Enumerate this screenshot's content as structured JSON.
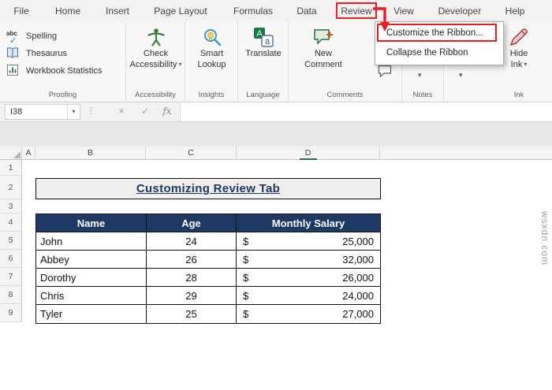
{
  "window": {
    "watermark": "wsxdn.com"
  },
  "ribbon_tabs": [
    {
      "label": "File"
    },
    {
      "label": "Home"
    },
    {
      "label": "Insert"
    },
    {
      "label": "Page Layout"
    },
    {
      "label": "Formulas"
    },
    {
      "label": "Data"
    },
    {
      "label": "Review"
    },
    {
      "label": "View"
    },
    {
      "label": "Developer"
    },
    {
      "label": "Help"
    }
  ],
  "ribbon": {
    "proofing": {
      "label": "Proofing",
      "buttons": [
        {
          "label": "Spelling"
        },
        {
          "label": "Thesaurus"
        },
        {
          "label": "Workbook Statistics"
        }
      ]
    },
    "accessibility": {
      "label": "Accessibility",
      "button_line1": "Check",
      "button_line2": "Accessibility"
    },
    "insights": {
      "label": "Insights",
      "button_line1": "Smart",
      "button_line2": "Lookup"
    },
    "language": {
      "label": "Language",
      "button": "Translate"
    },
    "comments": {
      "label": "Comments",
      "button_line1": "New",
      "button_line2": "Comment"
    },
    "notes": {
      "label": "Notes"
    },
    "ink": {
      "label": "Ink",
      "button_line1": "Hide",
      "button_line2": "Ink"
    }
  },
  "context_menu": {
    "items": [
      {
        "label": "Customize the Ribbon..."
      },
      {
        "label": "Collapse the Ribbon"
      }
    ]
  },
  "formula_bar": {
    "name_box": "I38",
    "fx_label": "fx"
  },
  "sheet": {
    "column_headers": [
      "A",
      "B",
      "C",
      "D"
    ],
    "row_headers": [
      "1",
      "2",
      "3",
      "4",
      "5",
      "6",
      "7",
      "8",
      "9"
    ],
    "title": "Customizing Review Tab",
    "table": {
      "headers": [
        "Name",
        "Age",
        "Monthly Salary"
      ],
      "rows": [
        {
          "name": "John",
          "age": "24",
          "cur": "$",
          "salary": "25,000"
        },
        {
          "name": "Abbey",
          "age": "26",
          "cur": "$",
          "salary": "32,000"
        },
        {
          "name": "Dorothy",
          "age": "28",
          "cur": "$",
          "salary": "26,000"
        },
        {
          "name": "Chris",
          "age": "29",
          "cur": "$",
          "salary": "24,000"
        },
        {
          "name": "Tyler",
          "age": "25",
          "cur": "$",
          "salary": "27,000"
        }
      ]
    }
  },
  "icons": {
    "dropdown": "▾",
    "more_dots": "⋮",
    "cancel": "×",
    "check": "✓",
    "spelling_abc": "abc",
    "translate_char1": "A",
    "translate_char2": "a"
  },
  "colors": {
    "annotation_red": "#ed1c24",
    "excel_green": "#217346",
    "table_header_bg": "#1f3864",
    "title_text": "#1f3864"
  }
}
